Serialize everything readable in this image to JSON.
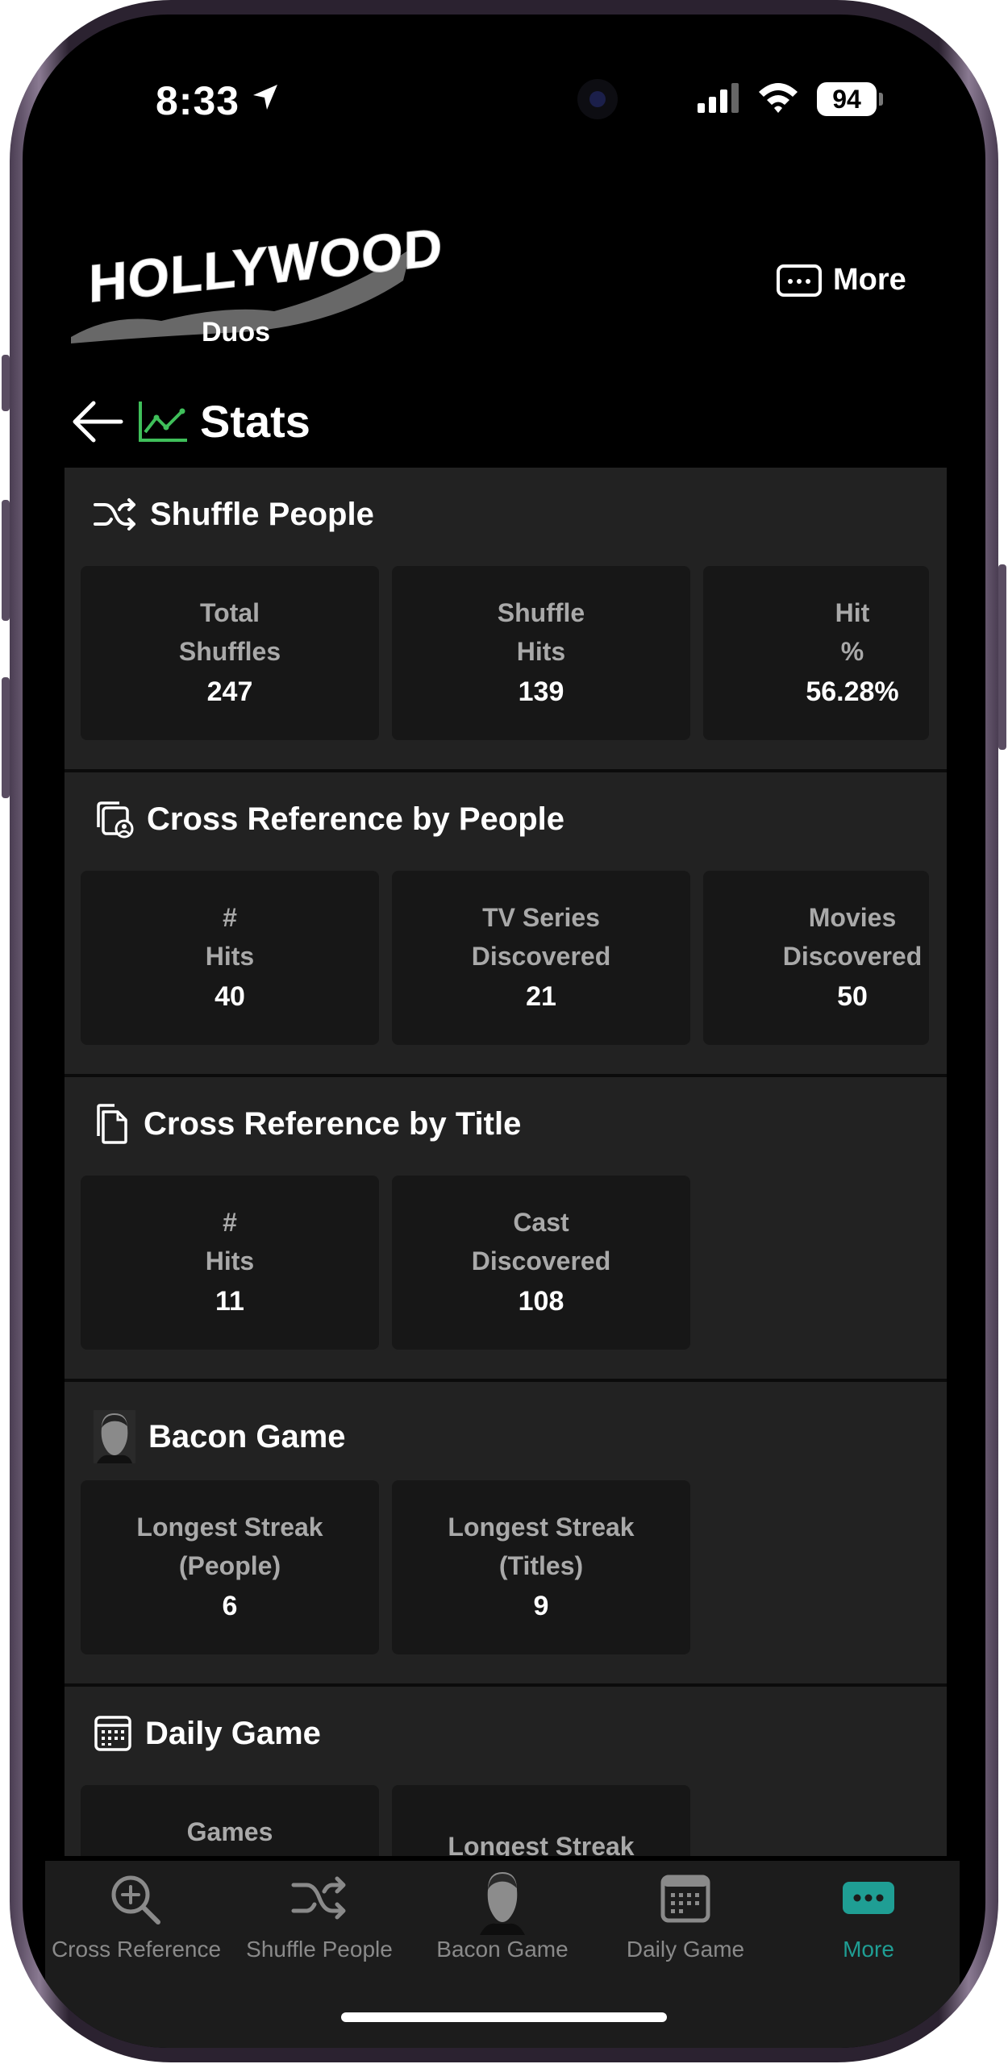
{
  "status": {
    "time": "8:33",
    "battery": "94"
  },
  "header": {
    "logo_text": "HOLLYWOOD",
    "logo_sub": "Duos",
    "more_label": "More",
    "page_title": "Stats"
  },
  "colors": {
    "accent": "#1f9e94",
    "chart_green": "#3fbf5a",
    "card_bg": "#171717",
    "section_bg": "#222222"
  },
  "sections": [
    {
      "title": "Shuffle People",
      "icon": "shuffle-icon",
      "cards": [
        {
          "label": "Total\nShuffles",
          "value": "247"
        },
        {
          "label": "Shuffle\nHits",
          "value": "139"
        },
        {
          "label": "Hit\n%",
          "value": "56.28%"
        }
      ]
    },
    {
      "title": "Cross Reference by People",
      "icon": "people-copy-icon",
      "cards": [
        {
          "label": "#\nHits",
          "value": "40"
        },
        {
          "label": "TV Series\nDiscovered",
          "value": "21"
        },
        {
          "label": "Movies\nDiscovered",
          "value": "50"
        }
      ]
    },
    {
      "title": "Cross Reference by Title",
      "icon": "documents-icon",
      "cards": [
        {
          "label": "#\nHits",
          "value": "11"
        },
        {
          "label": "Cast\nDiscovered",
          "value": "108"
        }
      ]
    },
    {
      "title": "Bacon Game",
      "icon": "actor-portrait-icon",
      "cards": [
        {
          "label": "Longest Streak\n(People)",
          "value": "6"
        },
        {
          "label": "Longest Streak\n(Titles)",
          "value": "9"
        }
      ]
    },
    {
      "title": "Daily Game",
      "icon": "calendar-icon",
      "cards": [
        {
          "label": "Games",
          "value": ""
        },
        {
          "label": "Longest Streak",
          "value": ""
        }
      ]
    }
  ],
  "tabs": [
    {
      "label": "Cross Reference",
      "icon": "magnify-plus-icon"
    },
    {
      "label": "Shuffle People",
      "icon": "shuffle-icon"
    },
    {
      "label": "Bacon Game",
      "icon": "actor-portrait-icon"
    },
    {
      "label": "Daily Game",
      "icon": "calendar-icon"
    },
    {
      "label": "More",
      "icon": "more-dots-icon",
      "active": true
    }
  ]
}
